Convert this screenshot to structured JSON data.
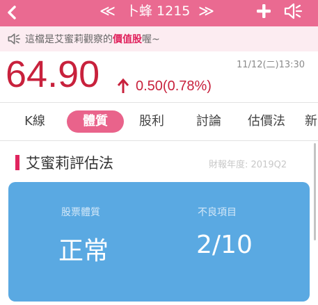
{
  "header": {
    "title": "卜蜂 1215",
    "prev": "≪",
    "next": "≫",
    "color": "#ea6a91"
  },
  "marquee": {
    "text_before": "這檔是艾蜜莉觀察的",
    "highlight": "價值股",
    "text_after": "喔~",
    "icon": "speaker-icon"
  },
  "quote": {
    "price": "64.90",
    "change": "0.50(0.78%)",
    "direction": "up",
    "timestamp": "11/12(二)13:30",
    "color": "#c8213c"
  },
  "tabs": [
    {
      "label": "K線",
      "active": false
    },
    {
      "label": "體質",
      "active": true
    },
    {
      "label": "股利",
      "active": false
    },
    {
      "label": "討論",
      "active": false
    },
    {
      "label": "估價法",
      "active": false
    },
    {
      "label": "新",
      "active": false
    }
  ],
  "section": {
    "title": "艾蜜莉評估法",
    "report_year": "財報年度: 2019Q2"
  },
  "card": {
    "health_label": "股票體質",
    "health_value": "正常",
    "bad_items_label": "不良項目",
    "bad_items_value": "2/10",
    "color": "#5aa9e2"
  }
}
